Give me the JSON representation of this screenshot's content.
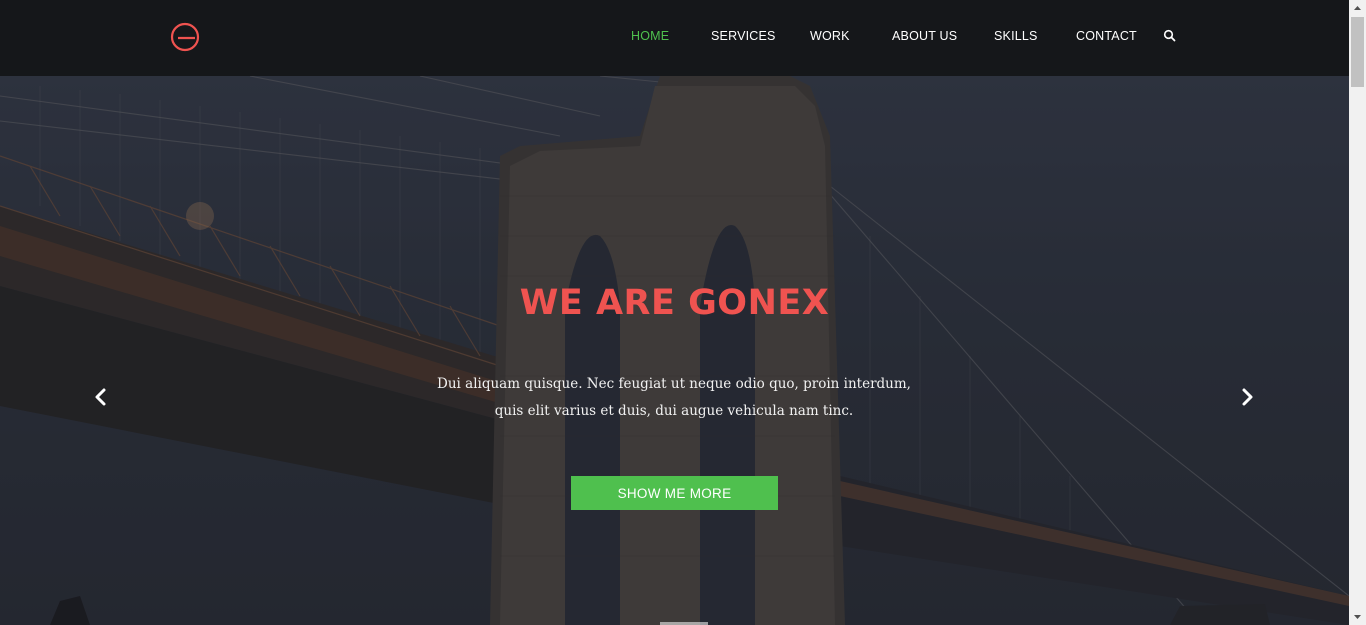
{
  "header": {
    "logo_icon": "g-logo-icon",
    "nav": [
      {
        "label": "HOME",
        "active": true
      },
      {
        "label": "SERVICES",
        "active": false
      },
      {
        "label": "WORK",
        "active": false
      },
      {
        "label": "ABOUT US",
        "active": false
      },
      {
        "label": "SKILLS",
        "active": false
      },
      {
        "label": "CONTACT",
        "active": false
      }
    ],
    "search_icon": "search-icon"
  },
  "hero": {
    "title": "WE ARE GONEX",
    "text_line1": "Dui aliquam quisque. Nec feugiat ut neque odio quo, proin interdum,",
    "text_line2": "quis elit varius et duis, dui augue vehicula nam tinc.",
    "button_label": "SHOW ME MORE",
    "prev_icon": "chevron-left-icon",
    "next_icon": "chevron-right-icon"
  },
  "colors": {
    "accent_red": "#ef5350",
    "accent_green": "#4fc04e",
    "header_bg": "#15171a"
  }
}
